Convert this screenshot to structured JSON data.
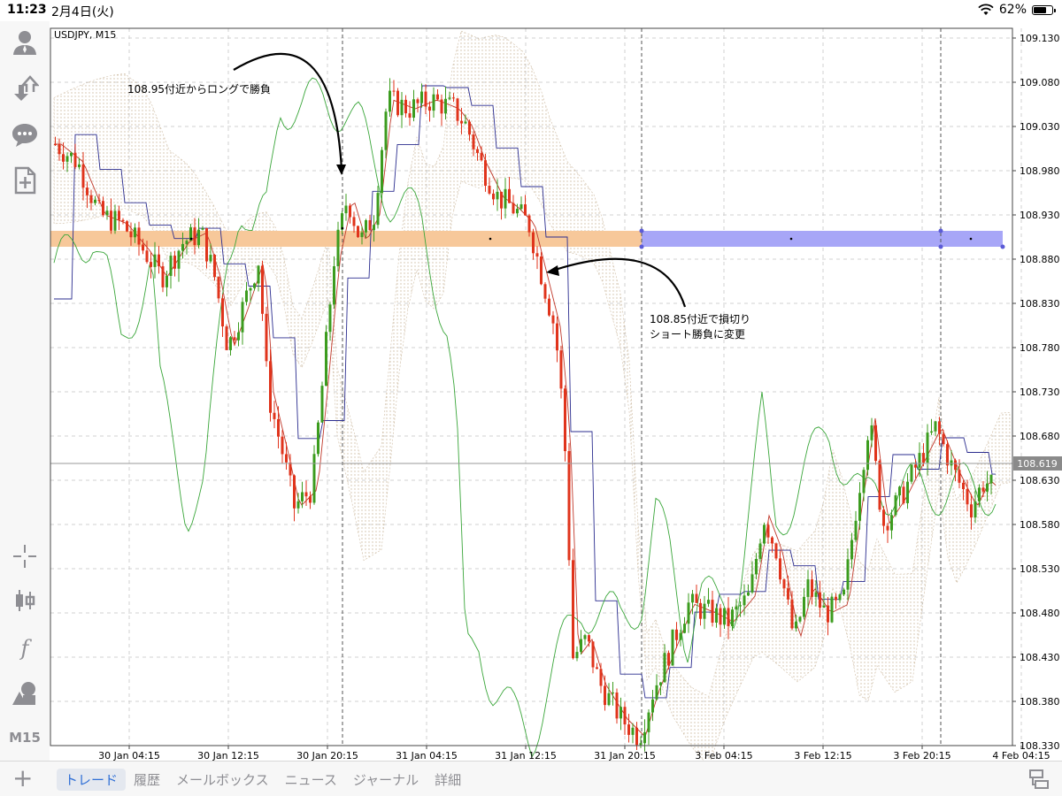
{
  "status_bar": {
    "time": "11:23",
    "date": "2月4日(火)",
    "battery": "62%",
    "battery_level": 0.62
  },
  "left_toolbar": {
    "items": [
      "account-icon",
      "trade-icon",
      "chat-icon",
      "new-order-icon",
      "crosshair-icon",
      "candlestick-icon",
      "indicator-icon",
      "objects-icon"
    ],
    "timeframe": "M15"
  },
  "chart": {
    "symbol_label": "USDJPY, M15",
    "current_price": "108.619",
    "price_levels": [
      "109.130",
      "109.080",
      "109.030",
      "108.980",
      "108.930",
      "108.880",
      "108.830",
      "108.780",
      "108.730",
      "108.680",
      "108.630",
      "108.580",
      "108.530",
      "108.480",
      "108.430",
      "108.380",
      "108.330"
    ],
    "time_labels": [
      "30 Jan 04:15",
      "30 Jan 12:15",
      "30 Jan 20:15",
      "31 Jan 04:15",
      "31 Jan 12:15",
      "31 Jan 20:15",
      "3 Feb 04:15",
      "3 Feb 12:15",
      "3 Feb 20:15",
      "4 Feb 04:15"
    ],
    "annotations": {
      "long_note": "108.95付近からロングで勝負",
      "stop_note_line1": "108.85付近で損切り",
      "stop_note_line2": "ショート勝負に変更"
    },
    "colors": {
      "bull": "#3c9c1f",
      "bear": "#e0341c",
      "zone_orange": "#f7c89a",
      "zone_blue": "#a7a6f7",
      "kijun": "#2b2d8f",
      "tenkan": "#c0392b",
      "chikou": "#3aa63a",
      "kumo": "#c9b59a"
    }
  },
  "tabbar": {
    "tabs": [
      "トレード",
      "履歴",
      "メールボックス",
      "ニュース",
      "ジャーナル",
      "詳細"
    ],
    "active_tab": "トレード"
  }
}
